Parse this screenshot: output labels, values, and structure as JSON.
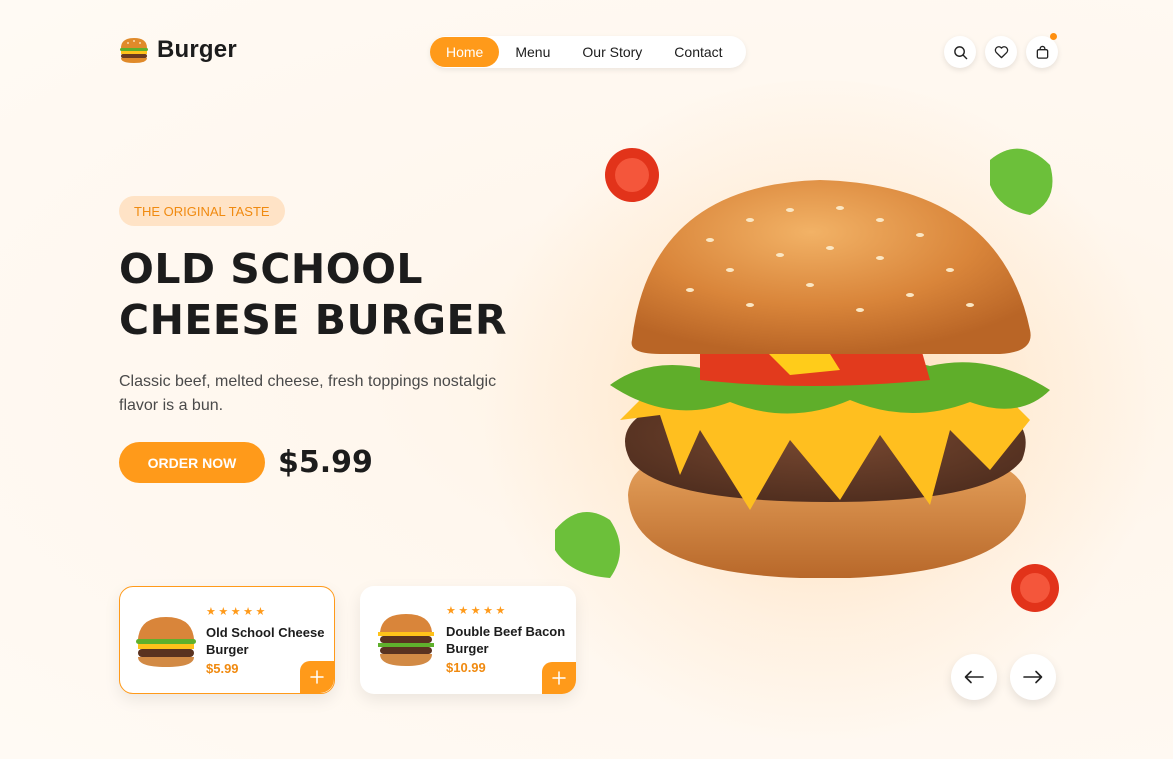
{
  "brand": {
    "name": "Burger"
  },
  "nav": {
    "items": [
      {
        "label": "Home",
        "active": true
      },
      {
        "label": "Menu",
        "active": false
      },
      {
        "label": "Our Story",
        "active": false
      },
      {
        "label": "Contact",
        "active": false
      }
    ]
  },
  "header_icons": [
    "search-icon",
    "heart-icon",
    "shopping-bag-icon"
  ],
  "hero": {
    "tag": "THE ORIGINAL TASTE",
    "title_line1": "OLD SCHOOL",
    "title_line2": "CHEESE BURGER",
    "description": "Classic beef, melted cheese, fresh toppings nostalgic flavor is a bun.",
    "cta_label": "ORDER NOW",
    "price": "$5.99"
  },
  "products": [
    {
      "name": "Old School Cheese Burger",
      "price": "$5.99",
      "rating": 5,
      "selected": true
    },
    {
      "name": "Double Beef Bacon Burger",
      "price": "$10.99",
      "rating": 5,
      "selected": false
    }
  ],
  "carousel": {
    "prev_icon": "arrow-left-icon",
    "next_icon": "arrow-right-icon"
  },
  "colors": {
    "accent": "#ff9a1a",
    "tag_bg": "#ffe3c6",
    "background": "#fff7ee",
    "text": "#1c1c1c"
  }
}
